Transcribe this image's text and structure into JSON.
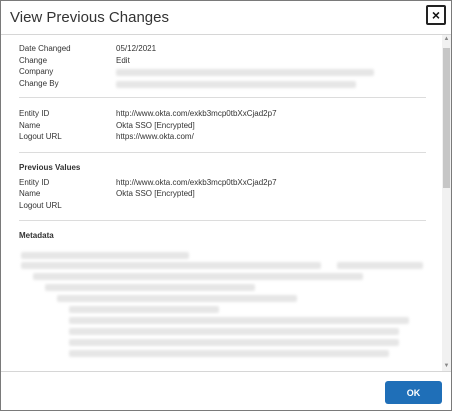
{
  "dialog": {
    "title": "View Previous Changes",
    "close_label": "×",
    "ok_label": "OK"
  },
  "summary": {
    "date_changed_label": "Date Changed",
    "date_changed_value": "05/12/2021",
    "change_label": "Change",
    "change_value": "Edit",
    "company_label": "Company",
    "change_by_label": "Change By"
  },
  "current": {
    "entity_id_label": "Entity ID",
    "entity_id_value": "http://www.okta.com/exkb3mcp0tbXxCjad2p7",
    "name_label": "Name",
    "name_value": "Okta SSO [Encrypted]",
    "logout_url_label": "Logout URL",
    "logout_url_value": "https://www.okta.com/"
  },
  "previous": {
    "section_title": "Previous Values",
    "entity_id_label": "Entity ID",
    "entity_id_value": "http://www.okta.com/exkb3mcp0tbXxCjad2p7",
    "name_label": "Name",
    "name_value": "Okta SSO [Encrypted]",
    "logout_url_label": "Logout URL"
  },
  "metadata": {
    "section_title": "Metadata"
  },
  "icons": {
    "close": "close-icon",
    "scroll_up": "chevron-up-icon",
    "scroll_down": "chevron-down-icon"
  },
  "colors": {
    "primary_button": "#1f6fb8"
  }
}
